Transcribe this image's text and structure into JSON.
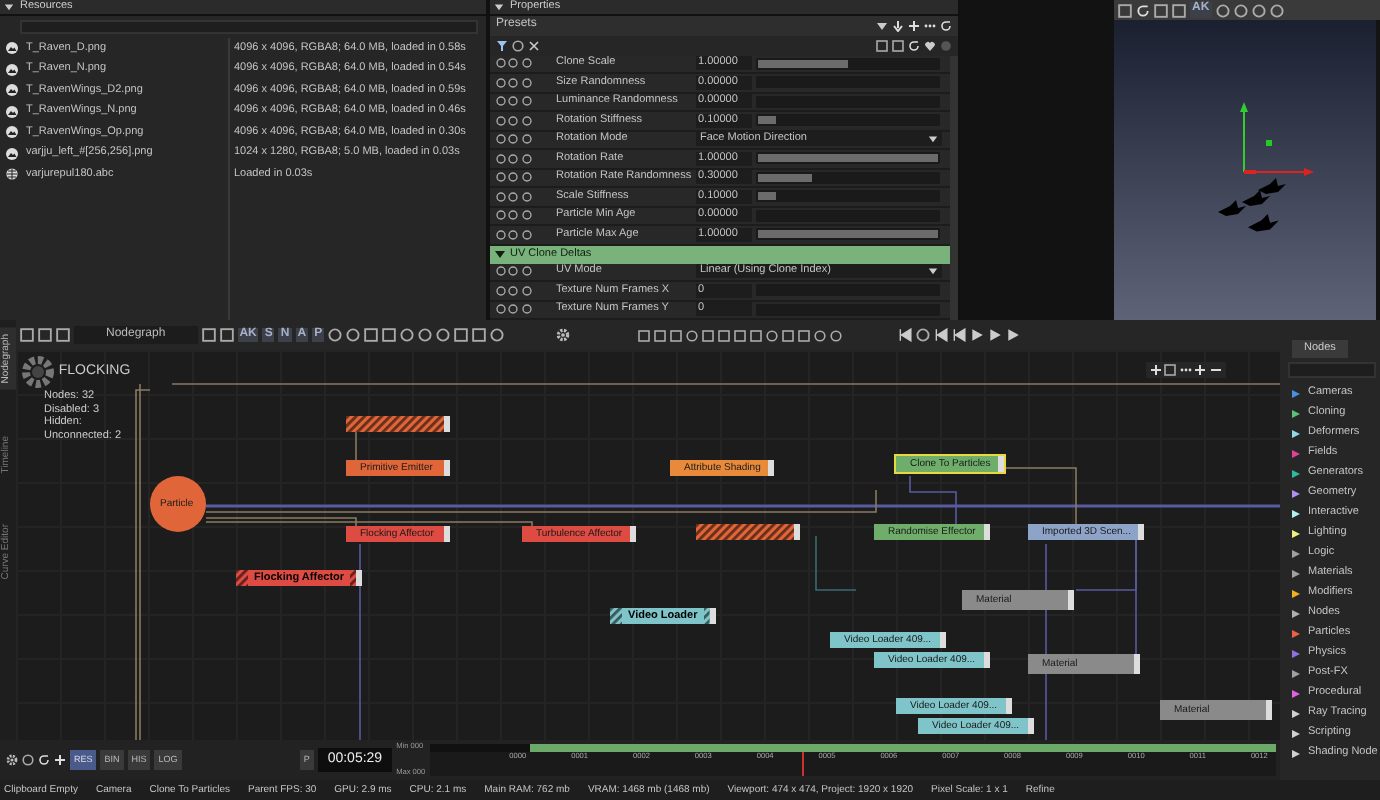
{
  "resources": {
    "title": "Resources",
    "items": [
      {
        "kind": "image",
        "name": "T_Raven_D.png",
        "info": "4096 x 4096, RGBA8; 64.0 MB, loaded in 0.58s"
      },
      {
        "kind": "image",
        "name": "T_Raven_N.png",
        "info": "4096 x 4096, RGBA8; 64.0 MB, loaded in 0.54s"
      },
      {
        "kind": "image",
        "name": "T_RavenWings_D2.png",
        "info": "4096 x 4096, RGBA8; 64.0 MB, loaded in 0.59s"
      },
      {
        "kind": "image",
        "name": "T_RavenWings_N.png",
        "info": "4096 x 4096, RGBA8; 64.0 MB, loaded in 0.46s"
      },
      {
        "kind": "image",
        "name": "T_RavenWings_Op.png",
        "info": "4096 x 4096, RGBA8; 64.0 MB, loaded in 0.30s"
      },
      {
        "kind": "image",
        "name": "varjju_left_#[256,256].png",
        "info": "1024 x 1280, RGBA8; 5.0 MB, loaded in 0.03s"
      },
      {
        "kind": "mesh",
        "name": "varjurepul180.abc",
        "info": "Loaded in 0.03s"
      }
    ]
  },
  "properties": {
    "title": "Properties",
    "presets_label": "Presets",
    "rows": [
      {
        "kind": "slider",
        "label": "Clone Scale",
        "value": "1.00000",
        "level": 0.5
      },
      {
        "kind": "slider",
        "label": "Size Randomness",
        "value": "0.00000",
        "level": 0
      },
      {
        "kind": "slider",
        "label": "Luminance Randomness",
        "value": "0.00000",
        "level": 0
      },
      {
        "kind": "slider",
        "label": "Rotation Stiffness",
        "value": "0.10000",
        "level": 0.1
      },
      {
        "kind": "dropdown",
        "label": "Rotation Mode",
        "value": "Face Motion Direction"
      },
      {
        "kind": "slider",
        "label": "Rotation Rate",
        "value": "1.00000",
        "level": 1
      },
      {
        "kind": "slider",
        "label": "Rotation Rate Randomness",
        "value": "0.30000",
        "level": 0.3
      },
      {
        "kind": "slider",
        "label": "Scale Stiffness",
        "value": "0.10000",
        "level": 0.1
      },
      {
        "kind": "slider",
        "label": "Particle Min Age",
        "value": "0.00000",
        "level": 0
      },
      {
        "kind": "slider",
        "label": "Particle Max Age",
        "value": "1.00000",
        "level": 1
      }
    ],
    "section": {
      "title": "UV Clone Deltas",
      "expanded": true,
      "rows": [
        {
          "kind": "dropdown",
          "label": "UV Mode",
          "value": "Linear (Using Clone Index)"
        },
        {
          "kind": "slider",
          "label": "Texture Num Frames X",
          "value": "0",
          "level": 0
        },
        {
          "kind": "slider",
          "label": "Texture Num Frames Y",
          "value": "0",
          "level": 0
        }
      ]
    }
  },
  "viewport": {
    "toolbar_label": "AK"
  },
  "side_tabs": [
    {
      "label": "Nodegraph",
      "selected": true
    },
    {
      "label": "Timeline",
      "selected": false
    },
    {
      "label": "Curve Editor",
      "selected": false
    }
  ],
  "nodegraph": {
    "tab": "Nodegraph",
    "letters": [
      "AK",
      "S",
      "N",
      "A",
      "P"
    ],
    "info": {
      "title": "FLOCKING",
      "lines": [
        "Nodes: 32",
        "Disabled: 3",
        "Hidden:",
        "Unconnected: 2"
      ]
    },
    "nodes": [
      {
        "kind": "circle",
        "label": "Particle",
        "color": "#e0663a",
        "disabled": false,
        "selected": false
      },
      {
        "kind": "box",
        "color": "#e0663a",
        "disabled": true,
        "selected": false
      },
      {
        "kind": "box",
        "label": "Primitive Emitter",
        "color": "#e0663a",
        "disabled": false,
        "selected": false
      },
      {
        "kind": "box",
        "label": "Flocking Affector",
        "color": "#dd4b43",
        "disabled": false,
        "selected": false
      },
      {
        "kind": "box",
        "label": "Turbulence Affector",
        "color": "#dd4b43",
        "disabled": false,
        "selected": false
      },
      {
        "kind": "box",
        "label": "Flocking Affector",
        "color": "#dd4b43",
        "disabled": true,
        "selected": false
      },
      {
        "kind": "box",
        "label": "Attribute Shading",
        "color": "#e88a3a",
        "disabled": false,
        "selected": false
      },
      {
        "kind": "box",
        "color": "#e0663a",
        "disabled": true,
        "selected": false
      },
      {
        "kind": "box",
        "label": "Clone To Particles",
        "color": "#6fae6a",
        "disabled": false,
        "selected": true
      },
      {
        "kind": "box",
        "label": "Randomise Effector",
        "color": "#6fae6a",
        "disabled": false,
        "selected": false
      },
      {
        "kind": "box",
        "label": "Imported 3D Scen...",
        "color": "#8ea3c8",
        "disabled": false,
        "selected": false
      },
      {
        "kind": "box",
        "label": "Video Loader",
        "color": "#7fc4c8",
        "disabled": true,
        "selected": false
      },
      {
        "kind": "material",
        "label": "Material",
        "color": "#8a8a8a",
        "disabled": false,
        "selected": false
      },
      {
        "kind": "box",
        "label": "Video Loader 409...",
        "color": "#7fc4c8",
        "disabled": false,
        "selected": false
      },
      {
        "kind": "box",
        "label": "Video Loader 409...",
        "color": "#7fc4c8",
        "disabled": false,
        "selected": false
      },
      {
        "kind": "material",
        "label": "Material",
        "color": "#8a8a8a",
        "disabled": false,
        "selected": false
      },
      {
        "kind": "box",
        "label": "Video Loader 409...",
        "color": "#7fc4c8",
        "disabled": false,
        "selected": false
      },
      {
        "kind": "box",
        "label": "Video Loader 409...",
        "color": "#7fc4c8",
        "disabled": false,
        "selected": false
      },
      {
        "kind": "material",
        "label": "Material",
        "color": "#8a8a8a",
        "disabled": false,
        "selected": false
      }
    ]
  },
  "library": {
    "tab": "Nodes",
    "items": [
      {
        "label": "Cameras",
        "color": "#4a8ee0"
      },
      {
        "label": "Cloning",
        "color": "#5bc07a"
      },
      {
        "label": "Deformers",
        "color": "#8fd8e8"
      },
      {
        "label": "Fields",
        "color": "#e0409a"
      },
      {
        "label": "Generators",
        "color": "#30b8a0"
      },
      {
        "label": "Geometry",
        "color": "#b090f0"
      },
      {
        "label": "Interactive",
        "color": "#b0f0f0"
      },
      {
        "label": "Lighting",
        "color": "#f0f080"
      },
      {
        "label": "Logic",
        "color": "#a0a0a0"
      },
      {
        "label": "Materials",
        "color": "#a0a0a0"
      },
      {
        "label": "Modifiers",
        "color": "#f0b020"
      },
      {
        "label": "Nodes",
        "color": "#b0b0b0"
      },
      {
        "label": "Particles",
        "color": "#f06040"
      },
      {
        "label": "Physics",
        "color": "#9070e0"
      },
      {
        "label": "Post-FX",
        "color": "#a0a0a0"
      },
      {
        "label": "Procedural",
        "color": "#e060e0"
      },
      {
        "label": "Ray Tracing",
        "color": "#d0d0d0"
      },
      {
        "label": "Scripting",
        "color": "#d0d0d0"
      },
      {
        "label": "Shading Node",
        "color": "#d0d0d0"
      }
    ]
  },
  "timeline": {
    "modes": [
      {
        "label": "RES",
        "selected": true
      },
      {
        "label": "BIN",
        "selected": false
      },
      {
        "label": "HIS",
        "selected": false
      },
      {
        "label": "LOG",
        "selected": false
      }
    ],
    "p_button": "P",
    "time": "00:05:29",
    "min_label": "Min 000",
    "max_label": "Max 000",
    "level": 0.44,
    "ticks": [
      "0000",
      "0001",
      "0002",
      "0003",
      "0004",
      "0005",
      "0006",
      "0007",
      "0008",
      "0009",
      "0010",
      "0011",
      "0012"
    ]
  },
  "status_bar": [
    "Clipboard Empty",
    "Camera",
    "Clone To Particles",
    "Parent FPS: 30",
    "GPU: 2.9 ms",
    "CPU: 2.1 ms",
    "Main RAM: 762 mb",
    "VRAM: 1468 mb (1468 mb)",
    "Viewport: 474 x 474, Project: 1920 x 1920",
    "Pixel Scale: 1 x 1",
    "Refine"
  ]
}
